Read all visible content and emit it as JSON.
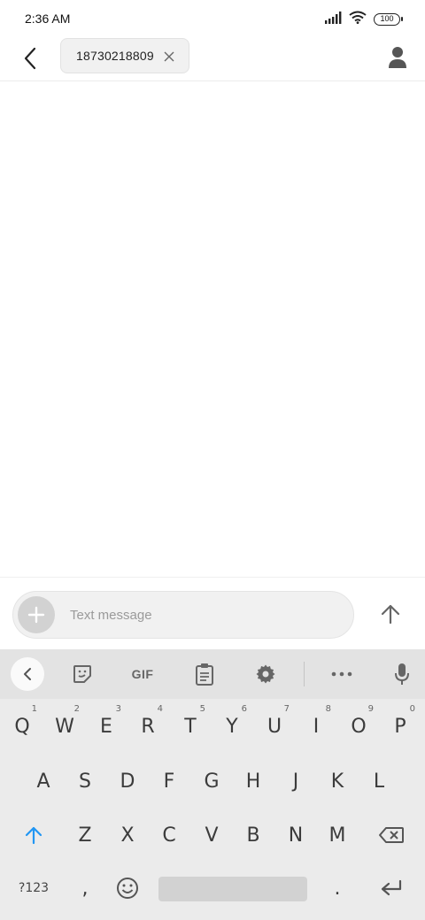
{
  "status_bar": {
    "time": "2:36 AM",
    "battery": "100",
    "icons": [
      "signal-icon",
      "wifi-icon",
      "battery-icon"
    ]
  },
  "header": {
    "recipient": "18730218809",
    "icons": [
      "back-arrow-icon",
      "close-icon",
      "person-icon"
    ]
  },
  "composer": {
    "placeholder": "Text message",
    "value": "",
    "icons": [
      "plus-icon",
      "send-arrow-up-icon"
    ]
  },
  "keyboard": {
    "toolbar": {
      "gif_label": "GIF",
      "icons": [
        "chevron-left-icon",
        "sticker-icon",
        "clipboard-icon",
        "gear-icon",
        "more-icon",
        "mic-icon"
      ]
    },
    "row1": [
      {
        "label": "Q",
        "hint": "1"
      },
      {
        "label": "W",
        "hint": "2"
      },
      {
        "label": "E",
        "hint": "3"
      },
      {
        "label": "R",
        "hint": "4"
      },
      {
        "label": "T",
        "hint": "5"
      },
      {
        "label": "Y",
        "hint": "6"
      },
      {
        "label": "U",
        "hint": "7"
      },
      {
        "label": "I",
        "hint": "8"
      },
      {
        "label": "O",
        "hint": "9"
      },
      {
        "label": "P",
        "hint": "0"
      }
    ],
    "row2": [
      "A",
      "S",
      "D",
      "F",
      "G",
      "H",
      "J",
      "K",
      "L"
    ],
    "row3": [
      "Z",
      "X",
      "C",
      "V",
      "B",
      "N",
      "M"
    ],
    "row4": {
      "symbols": "?123",
      "comma": ",",
      "period": "."
    },
    "accent_color": "#2196f3"
  }
}
